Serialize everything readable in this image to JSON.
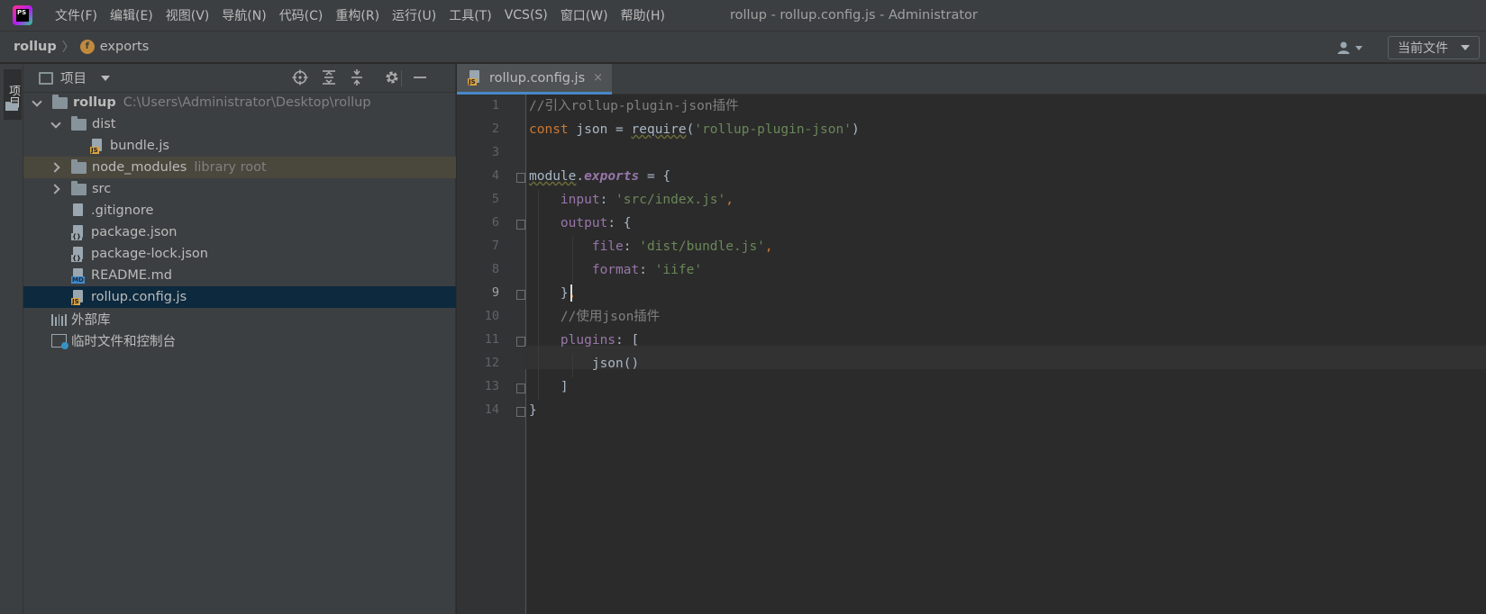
{
  "titlebar": {
    "menu": [
      "文件(F)",
      "编辑(E)",
      "视图(V)",
      "导航(N)",
      "代码(C)",
      "重构(R)",
      "运行(U)",
      "工具(T)",
      "VCS(S)",
      "窗口(W)",
      "帮助(H)"
    ],
    "window_title": "rollup - rollup.config.js - Administrator",
    "logo_text": "PS"
  },
  "navbar": {
    "crumb_root": "rollup",
    "crumb_separator": "〉",
    "crumb_symbol_badge": "f",
    "crumb_symbol": "exports",
    "run_config_label": "当前文件"
  },
  "toolstrip": {
    "project_tab_label": "项目"
  },
  "project_panel": {
    "title": "项目",
    "tree": [
      {
        "label": "rollup",
        "hint": "C:\\Users\\Administrator\\Desktop\\rollup",
        "kind": "folder",
        "expanded": true
      },
      {
        "label": "dist",
        "hint": "",
        "kind": "folder",
        "expanded": true
      },
      {
        "label": "bundle.js",
        "hint": "",
        "kind": "file",
        "badge": "JS"
      },
      {
        "label": "node_modules",
        "hint": "library root",
        "kind": "folder",
        "expanded": false
      },
      {
        "label": "src",
        "hint": "",
        "kind": "folder",
        "expanded": false
      },
      {
        "label": ".gitignore",
        "hint": "",
        "kind": "file",
        "badge": ""
      },
      {
        "label": "package.json",
        "hint": "",
        "kind": "file",
        "badge": "{}"
      },
      {
        "label": "package-lock.json",
        "hint": "",
        "kind": "file",
        "badge": "{}"
      },
      {
        "label": "README.md",
        "hint": "",
        "kind": "file",
        "badge": "MD"
      },
      {
        "label": "rollup.config.js",
        "hint": "",
        "kind": "file",
        "badge": "JS",
        "selected": true
      },
      {
        "label": "外部库",
        "hint": "",
        "kind": "library"
      },
      {
        "label": "临时文件和控制台",
        "hint": "",
        "kind": "scratch"
      }
    ]
  },
  "editor": {
    "active_tab": "rollup.config.js",
    "tab_badge": "JS",
    "close_glyph": "×",
    "current_line": 9,
    "line_numbers": [
      "1",
      "2",
      "3",
      "4",
      "5",
      "6",
      "7",
      "8",
      "9",
      "10",
      "11",
      "12",
      "13",
      "14"
    ],
    "lines": [
      "//引入rollup-plugin-json插件",
      "const json = require('rollup-plugin-json')",
      "",
      "module.exports = {",
      "    input: 'src/index.js',",
      "    output: {",
      "        file: 'dist/bundle.js',",
      "        format: 'iife'",
      "    },",
      "    //使用json插件",
      "    plugins: [",
      "        json()",
      "    ]",
      "}"
    ]
  },
  "colors": {
    "keyword": "#cc7832",
    "string": "#6a8759",
    "comment": "#808080",
    "property": "#9876aa",
    "selection": "#0d293e",
    "accent": "#4a88c7"
  }
}
